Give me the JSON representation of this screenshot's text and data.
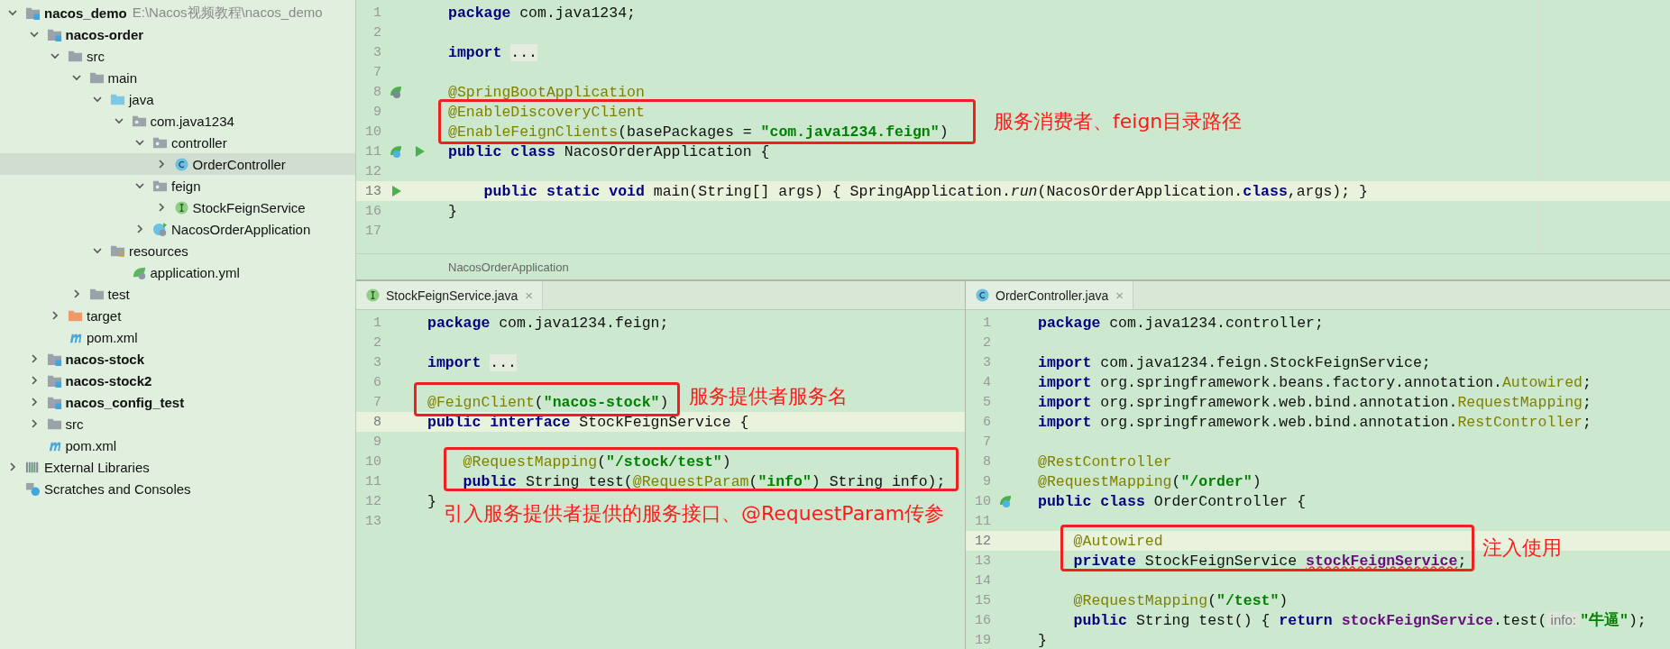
{
  "tree": [
    {
      "label": "nacos_demo",
      "hint": "E:\\Nacos视频教程\\nacos_demo",
      "kind": "module",
      "expanded": true,
      "selected": false,
      "children": [
        {
          "label": "nacos-order",
          "kind": "module",
          "expanded": true,
          "selected": false,
          "children": [
            {
              "label": "src",
              "kind": "folder",
              "expanded": true,
              "selected": false,
              "children": [
                {
                  "label": "main",
                  "kind": "folder",
                  "expanded": true,
                  "selected": false,
                  "children": [
                    {
                      "label": "java",
                      "kind": "source",
                      "expanded": true,
                      "selected": false,
                      "children": [
                        {
                          "label": "com.java1234",
                          "kind": "package",
                          "expanded": true,
                          "selected": false,
                          "children": [
                            {
                              "label": "controller",
                              "kind": "package",
                              "expanded": true,
                              "selected": false,
                              "children": [
                                {
                                  "label": "OrderController",
                                  "kind": "class",
                                  "expanded": false,
                                  "selected": true
                                }
                              ]
                            },
                            {
                              "label": "feign",
                              "kind": "package",
                              "expanded": true,
                              "selected": false,
                              "children": [
                                {
                                  "label": "StockFeignService",
                                  "kind": "interface",
                                  "expanded": false,
                                  "selected": false
                                }
                              ]
                            },
                            {
                              "label": "NacosOrderApplication",
                              "kind": "spring",
                              "expanded": false,
                              "selected": false
                            }
                          ]
                        }
                      ]
                    },
                    {
                      "label": "resources",
                      "kind": "resources",
                      "expanded": true,
                      "selected": false,
                      "children": [
                        {
                          "label": "application.yml",
                          "kind": "yml",
                          "selected": false
                        }
                      ]
                    }
                  ]
                },
                {
                  "label": "test",
                  "kind": "folder",
                  "expanded": false,
                  "selected": false
                }
              ]
            },
            {
              "label": "target",
              "kind": "excluded",
              "expanded": false,
              "selected": false
            },
            {
              "label": "pom.xml",
              "kind": "maven",
              "selected": false
            }
          ]
        },
        {
          "label": "nacos-stock",
          "kind": "module",
          "expanded": false,
          "selected": false
        },
        {
          "label": "nacos-stock2",
          "kind": "module",
          "expanded": false,
          "selected": false
        },
        {
          "label": "nacos_config_test",
          "kind": "module",
          "expanded": false,
          "selected": false
        },
        {
          "label": "src",
          "kind": "folder",
          "expanded": false,
          "selected": false
        },
        {
          "label": "pom.xml",
          "kind": "maven",
          "selected": false
        }
      ]
    },
    {
      "label": "External Libraries",
      "kind": "libraries",
      "expanded": false,
      "selected": false
    },
    {
      "label": "Scratches and Consoles",
      "kind": "scratches",
      "selected": false
    }
  ],
  "top_editor": {
    "breadcrumb": "NacosOrderApplication",
    "lines": [
      {
        "number": "1",
        "current": false,
        "tokens": [
          {
            "text": "package",
            "kind": "kw"
          },
          {
            "text": " com.java1234;",
            "kind": "plain"
          }
        ]
      },
      {
        "number": "2",
        "current": false
      },
      {
        "number": "3",
        "current": false,
        "tokens": [
          {
            "text": "import",
            "kind": "kw"
          },
          {
            "text": "...",
            "kind": "fold"
          }
        ]
      },
      {
        "number": "7",
        "current": false
      },
      {
        "number": "8",
        "current": false,
        "markers": [
          {
            "kind": "bean-search"
          }
        ],
        "tokens": [
          {
            "text": "@SpringBootApplication",
            "kind": "ann"
          }
        ]
      },
      {
        "number": "9",
        "current": false,
        "tokens": [
          {
            "text": "@EnableDiscoveryClient",
            "kind": "ann"
          }
        ]
      },
      {
        "number": "10",
        "current": false,
        "tokens": [
          {
            "text": "@EnableFeignClients",
            "kind": "ann"
          },
          {
            "text": "(basePackages = ",
            "kind": "plain"
          },
          {
            "text": "\"com.java1234.feign\"",
            "kind": "str"
          },
          {
            "text": ")",
            "kind": "plain"
          }
        ]
      },
      {
        "number": "11",
        "current": false,
        "markers": [
          {
            "kind": "bean"
          },
          {
            "kind": "run"
          }
        ],
        "tokens": [
          {
            "text": "public class",
            "kind": "kw"
          },
          {
            "text": " NacosOrderApplication {",
            "kind": "plain"
          }
        ]
      },
      {
        "number": "12",
        "current": false
      },
      {
        "number": "13",
        "current": true,
        "markers": [
          {
            "kind": "run"
          }
        ],
        "tokens": [
          {
            "text": "    public static void",
            "kind": "kw"
          },
          {
            "text": " main(String[] args) { SpringApplication.",
            "kind": "plain"
          },
          {
            "text": "run",
            "kind": "italic"
          },
          {
            "text": "(NacosOrderApplication.",
            "kind": "plain"
          },
          {
            "text": "class",
            "kind": "kw"
          },
          {
            "text": ",args); }",
            "kind": "plain"
          }
        ]
      },
      {
        "number": "16",
        "current": false,
        "tokens": [
          {
            "text": "}",
            "kind": "plain"
          }
        ]
      },
      {
        "number": "17",
        "current": false
      }
    ]
  },
  "bottom_editors": [
    {
      "tab": {
        "label": "StockFeignService.java",
        "kind": "interface",
        "close": "×"
      },
      "lines": [
        {
          "number": "1",
          "current": false,
          "tokens": [
            {
              "text": "package",
              "kind": "kw"
            },
            {
              "text": " com.java1234.feign;",
              "kind": "plain"
            }
          ]
        },
        {
          "number": "2",
          "current": false
        },
        {
          "number": "3",
          "current": false,
          "tokens": [
            {
              "text": "import",
              "kind": "kw"
            },
            {
              "text": "...",
              "kind": "fold"
            }
          ]
        },
        {
          "number": "6",
          "current": false
        },
        {
          "number": "7",
          "current": false,
          "tokens": [
            {
              "text": "@FeignClient",
              "kind": "ann"
            },
            {
              "text": "(",
              "kind": "plain"
            },
            {
              "text": "\"nacos-stock\"",
              "kind": "str"
            },
            {
              "text": ")",
              "kind": "plain"
            }
          ]
        },
        {
          "number": "8",
          "current": true,
          "tokens": [
            {
              "text": "public interface",
              "kind": "kw"
            },
            {
              "text": " StockFeignService {",
              "kind": "plain"
            }
          ]
        },
        {
          "number": "9",
          "current": false
        },
        {
          "number": "10",
          "current": false,
          "tokens": [
            {
              "text": "    @RequestMapping",
              "kind": "ann"
            },
            {
              "text": "(",
              "kind": "plain"
            },
            {
              "text": "\"/stock/test\"",
              "kind": "str"
            },
            {
              "text": ")",
              "kind": "plain"
            }
          ]
        },
        {
          "number": "11",
          "current": false,
          "tokens": [
            {
              "text": "    public",
              "kind": "kw"
            },
            {
              "text": " String test(",
              "kind": "plain"
            },
            {
              "text": "@RequestParam",
              "kind": "ann"
            },
            {
              "text": "(",
              "kind": "plain"
            },
            {
              "text": "\"info\"",
              "kind": "str"
            },
            {
              "text": ") String info);",
              "kind": "plain"
            }
          ]
        },
        {
          "number": "12",
          "current": false,
          "tokens": [
            {
              "text": "}",
              "kind": "plain"
            }
          ]
        },
        {
          "number": "13",
          "current": false
        }
      ]
    },
    {
      "tab": {
        "label": "OrderController.java",
        "kind": "class",
        "close": "×"
      },
      "lines": [
        {
          "number": "1",
          "current": false,
          "tokens": [
            {
              "text": "package",
              "kind": "kw"
            },
            {
              "text": " com.java1234.controller;",
              "kind": "plain"
            }
          ]
        },
        {
          "number": "2",
          "current": false
        },
        {
          "number": "3",
          "current": false,
          "tokens": [
            {
              "text": "import",
              "kind": "kw"
            },
            {
              "text": " com.java1234.feign.StockFeignService;",
              "kind": "plain"
            }
          ]
        },
        {
          "number": "4",
          "current": false,
          "tokens": [
            {
              "text": "import",
              "kind": "kw"
            },
            {
              "text": " org.springframework.beans.factory.annotation.",
              "kind": "plain"
            },
            {
              "text": "Autowired",
              "kind": "ann"
            },
            {
              "text": ";",
              "kind": "plain"
            }
          ]
        },
        {
          "number": "5",
          "current": false,
          "tokens": [
            {
              "text": "import",
              "kind": "kw"
            },
            {
              "text": " org.springframework.web.bind.annotation.",
              "kind": "plain"
            },
            {
              "text": "RequestMapping",
              "kind": "ann"
            },
            {
              "text": ";",
              "kind": "plain"
            }
          ]
        },
        {
          "number": "6",
          "current": false,
          "tokens": [
            {
              "text": "import",
              "kind": "kw"
            },
            {
              "text": " org.springframework.web.bind.annotation.",
              "kind": "plain"
            },
            {
              "text": "RestController",
              "kind": "ann"
            },
            {
              "text": ";",
              "kind": "plain"
            }
          ]
        },
        {
          "number": "7",
          "current": false
        },
        {
          "number": "8",
          "current": false,
          "tokens": [
            {
              "text": "@RestController",
              "kind": "ann"
            }
          ]
        },
        {
          "number": "9",
          "current": false,
          "tokens": [
            {
              "text": "@RequestMapping",
              "kind": "ann"
            },
            {
              "text": "(",
              "kind": "plain"
            },
            {
              "text": "\"/order\"",
              "kind": "str"
            },
            {
              "text": ")",
              "kind": "plain"
            }
          ]
        },
        {
          "number": "10",
          "current": false,
          "markers": [
            {
              "kind": "bean"
            }
          ],
          "tokens": [
            {
              "text": "public class",
              "kind": "kw"
            },
            {
              "text": " OrderController {",
              "kind": "plain"
            }
          ]
        },
        {
          "number": "11",
          "current": false
        },
        {
          "number": "12",
          "current": true,
          "tokens": [
            {
              "text": "    @Autowired",
              "kind": "ann"
            }
          ]
        },
        {
          "number": "13",
          "current": false,
          "tokens": [
            {
              "text": "    private",
              "kind": "kw"
            },
            {
              "text": " StockFeignService ",
              "kind": "plain"
            },
            {
              "text": "stockFeignService",
              "kind": "field-warn"
            },
            {
              "text": ";",
              "kind": "plain"
            }
          ]
        },
        {
          "number": "14",
          "current": false
        },
        {
          "number": "15",
          "current": false,
          "tokens": [
            {
              "text": "    @RequestMapping",
              "kind": "ann"
            },
            {
              "text": "(",
              "kind": "plain"
            },
            {
              "text": "\"/test\"",
              "kind": "str"
            },
            {
              "text": ")",
              "kind": "plain"
            }
          ]
        },
        {
          "number": "16",
          "current": false,
          "tokens": [
            {
              "text": "    public",
              "kind": "kw"
            },
            {
              "text": " String test() { ",
              "kind": "plain"
            },
            {
              "text": "return",
              "kind": "kw"
            },
            {
              "text": " stockFeignService",
              "kind": "field"
            },
            {
              "text": ".test(",
              "kind": "plain"
            },
            {
              "text": " info: ",
              "kind": "hint"
            },
            {
              "text": "\"牛逼\"",
              "kind": "str"
            },
            {
              "text": ");",
              "kind": "plain"
            }
          ]
        },
        {
          "number": "19",
          "current": false,
          "tokens": [
            {
              "text": "}",
              "kind": "plain"
            }
          ]
        }
      ]
    }
  ],
  "annotations": [
    {
      "text": "服务消费者、feign目录路径"
    },
    {
      "text": "服务提供者服务名"
    },
    {
      "text": "引入服务提供者提供的服务接口、@RequestParam传参"
    },
    {
      "text": "注入使用"
    }
  ]
}
